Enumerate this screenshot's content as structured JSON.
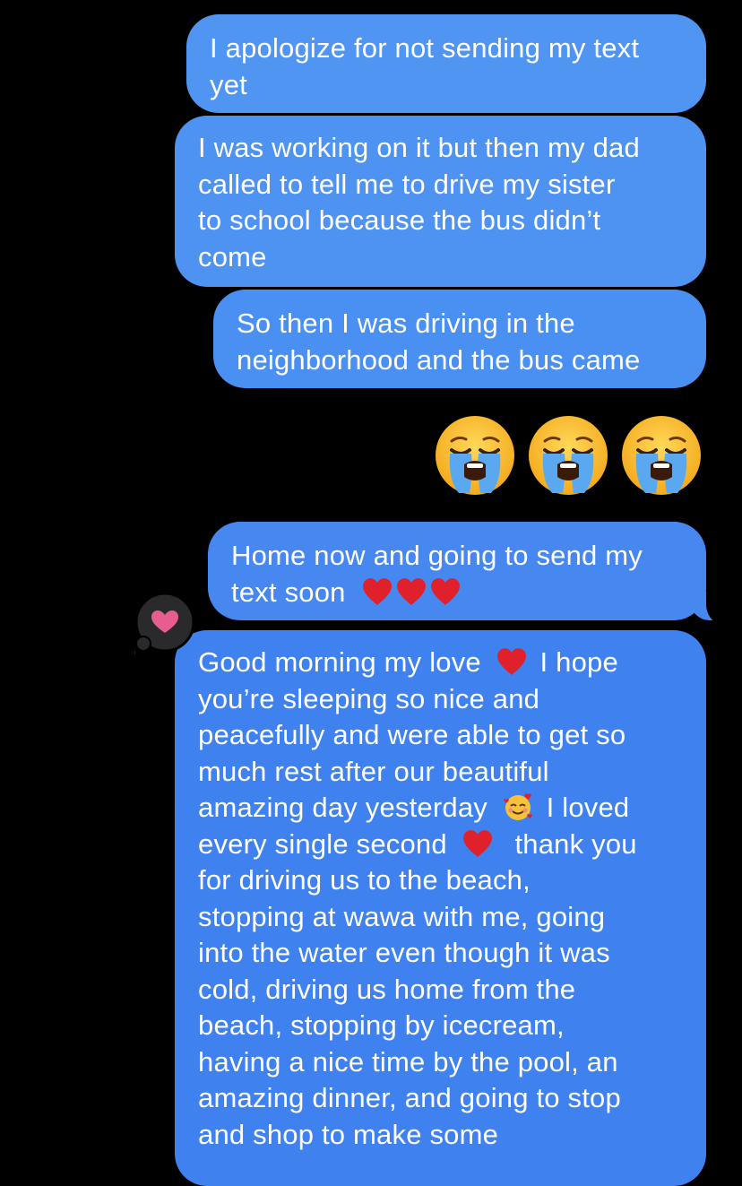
{
  "messages": [
    {
      "id": "m1",
      "lines": [
        "I apologize for not sending my text",
        "yet"
      ]
    },
    {
      "id": "m2",
      "lines": [
        "I was working on it but then my dad",
        "called to tell me to drive my sister",
        "to school because the bus didn’t",
        "come"
      ]
    },
    {
      "id": "m3",
      "lines": [
        "So then I was driving in the",
        "neighborhood and the bus came"
      ]
    },
    {
      "id": "m4",
      "lines": [
        "Home now and going to send my",
        "text soon"
      ]
    },
    {
      "id": "m5",
      "lines": [
        "Good morning my love",
        "I hope",
        "you’re sleeping so nice and",
        "peacefully and were able to get so",
        "much rest after our beautiful",
        "amazing day yesterday",
        "I loved",
        "every single second",
        "thank you",
        "for driving us to the beach,",
        "stopping at wawa with me, going",
        "into the water even though it was",
        "cold, driving us home from the",
        "beach, stopping by icecream,",
        "having a nice time by the pool, an",
        "amazing dinner, and going to stop",
        "and shop to make some"
      ]
    }
  ],
  "emoji_message": {
    "icons": [
      "loudly-crying-face-icon",
      "loudly-crying-face-icon",
      "loudly-crying-face-icon"
    ]
  },
  "reaction": {
    "icon": "heart-tapback-icon",
    "color": "#e85d8f"
  },
  "colors": {
    "bubble": "#4a8ff2",
    "background": "#000000",
    "text": "#ffffff",
    "heart": "#e0202a"
  }
}
